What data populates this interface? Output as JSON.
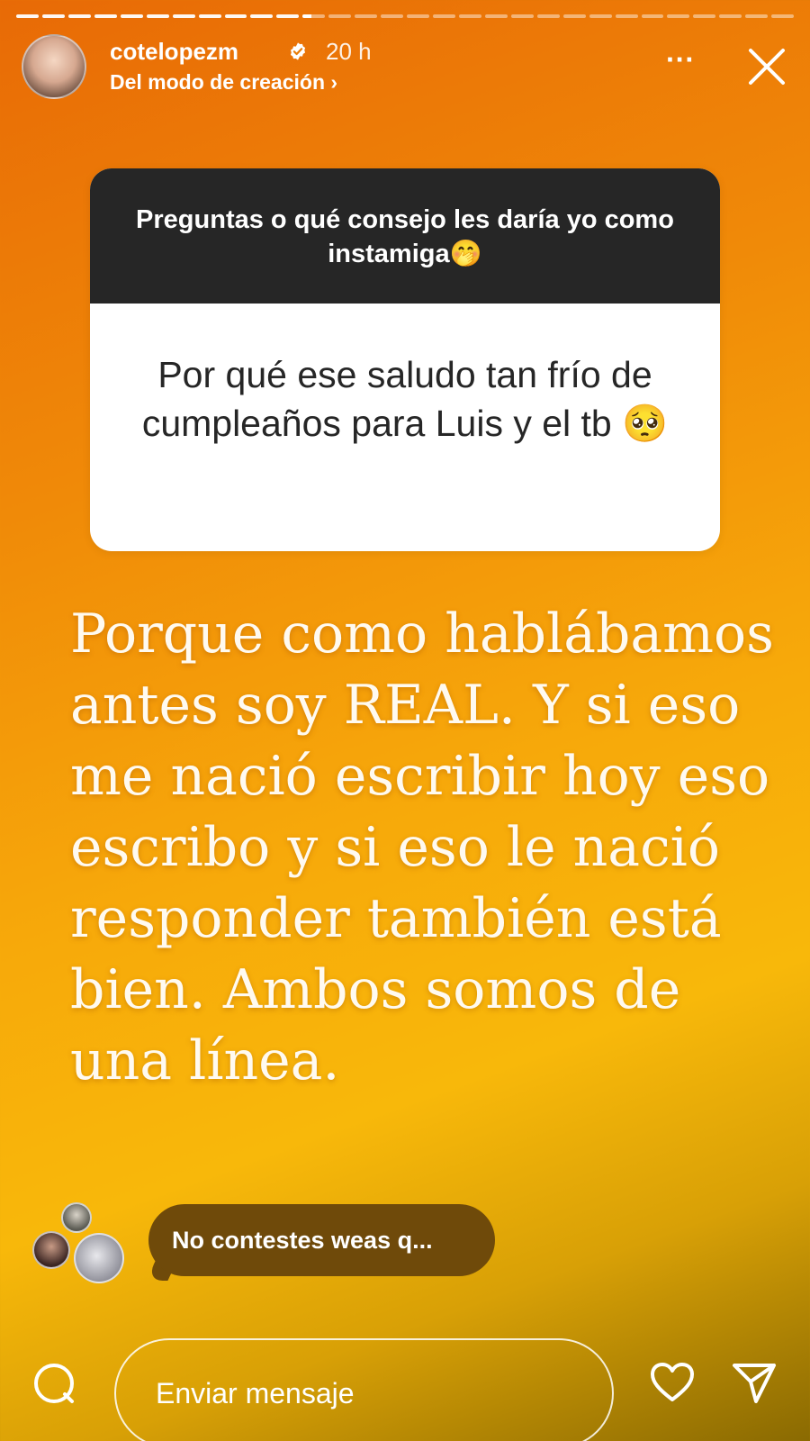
{
  "story": {
    "progress_segments": 30,
    "completed_segments": 11,
    "current_segment_fraction": 0.4
  },
  "header": {
    "username": "cotelopezm",
    "verified": true,
    "time": "20 h",
    "subtitle": "Del modo de creación ›",
    "more_icon": "more-horizontal-icon",
    "close_icon": "close-icon"
  },
  "question_card": {
    "prompt": "Preguntas o qué consejo les daría yo como instamiga🤭",
    "question": "Por qué ese saludo tan frío de cumpleaños para Luis y el tb 🥺"
  },
  "answer": {
    "text": "Porque como hablábamos antes soy REAL. Y si eso me nació escribir hoy eso escribo y si eso le nació responder también está bien. Ambos somos de una línea."
  },
  "reply_bubble": {
    "text": "No contestes weas q..."
  },
  "footer": {
    "message_placeholder": "Enviar mensaje",
    "camera_icon": "camera-icon",
    "heart_icon": "heart-icon",
    "send_icon": "send-icon"
  },
  "colors": {
    "gradient_top": "#e86a06",
    "gradient_mid": "#f8b80a",
    "card_header": "#262626",
    "bubble": "#6f4a0a"
  }
}
